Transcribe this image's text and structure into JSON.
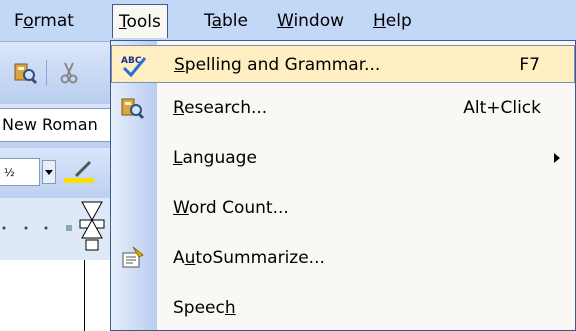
{
  "menubar": {
    "items": [
      {
        "pre": "F",
        "key": "o",
        "post": "rmat"
      },
      {
        "pre": "",
        "key": "T",
        "post": "ools"
      },
      {
        "pre": "T",
        "key": "a",
        "post": "ble"
      },
      {
        "pre": "",
        "key": "W",
        "post": "indow"
      },
      {
        "pre": "",
        "key": "H",
        "post": "elp"
      }
    ]
  },
  "document": {
    "font_name": "New Roman"
  },
  "tools_menu": {
    "items": [
      {
        "pre": "",
        "key": "S",
        "post": "pelling and Grammar...",
        "shortcut": "F7",
        "icon": "spelling-abc-icon"
      },
      {
        "pre": "",
        "key": "R",
        "post": "esearch...",
        "shortcut": "Alt+Click",
        "icon": "research-book-icon"
      },
      {
        "pre": "",
        "key": "L",
        "post": "anguage",
        "icon": "submenu-arrow-icon"
      },
      {
        "pre": "",
        "key": "W",
        "post": "ord Count..."
      },
      {
        "pre": "A",
        "key": "u",
        "post": "toSummarize...",
        "icon": "autosummarize-icon"
      },
      {
        "pre": "Speec",
        "key": "h",
        "post": ""
      }
    ]
  },
  "colors": {
    "menubar_bg": "#c3d7f6",
    "highlight_bg": "#ffeec2",
    "menu_border": "#3d5a8f"
  }
}
